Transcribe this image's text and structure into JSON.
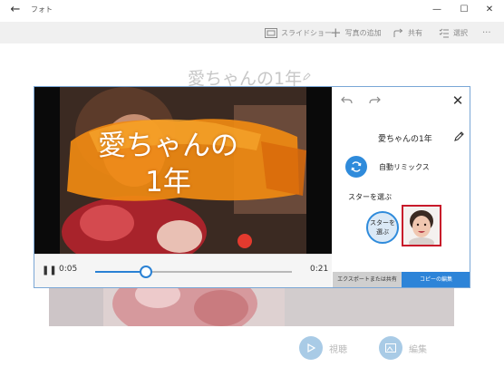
{
  "window": {
    "title": "フォト"
  },
  "toolbar": {
    "slideshow_label": "スライドショー",
    "add_photos_label": "写真の追加",
    "share_label": "共有",
    "select_label": "選択",
    "more_label": "···"
  },
  "album": {
    "title": "愛ちゃんの1年"
  },
  "bottom_actions": {
    "play_label": "視聴",
    "edit_label": "編集"
  },
  "player": {
    "caption_line1": "愛ちゃんの",
    "caption_line2": "1年",
    "current_time": "0:05",
    "end_time": "0:21",
    "progress_fraction": 0.26,
    "accent_color": "#2a81d4"
  },
  "panel": {
    "title": "愛ちゃんの1年",
    "auto_remix_label": "自動リミックス",
    "choose_stars_label": "スターを選ぶ",
    "star_button_line1": "スターを",
    "star_button_line2": "選ぶ",
    "export_tab_label": "エクスポートまたは共有",
    "edit_copy_tab_label": "コピーの編集"
  }
}
